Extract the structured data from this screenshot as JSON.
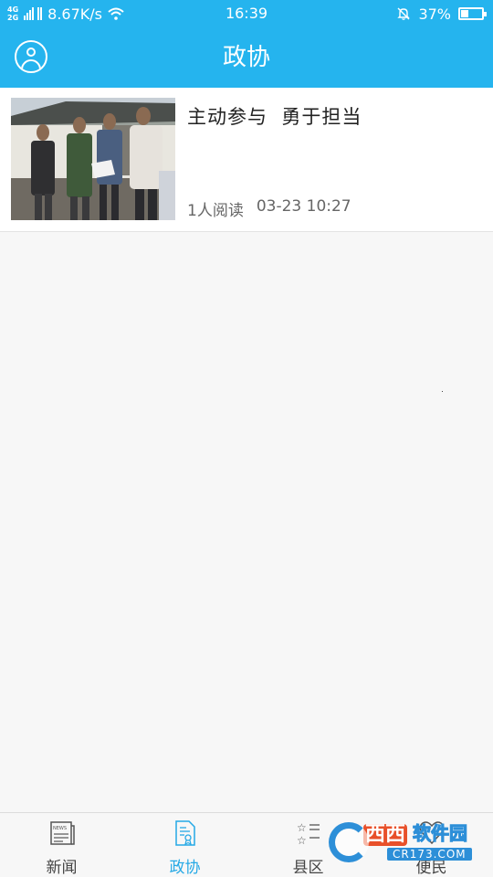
{
  "status_bar": {
    "network_type_top": "4G",
    "network_type_bottom": "2G",
    "speed": "8.67K/s",
    "time": "16:39",
    "battery_percent": "37%",
    "battery_level": 0.37
  },
  "header": {
    "title": "政协",
    "avatar_icon": "user-avatar-icon"
  },
  "news": [
    {
      "title": "主动参与  勇于担当",
      "reads": "1人阅读",
      "date": "03-23 10:27"
    }
  ],
  "tabs": [
    {
      "label": "新闻",
      "icon": "newspaper-icon",
      "active": false
    },
    {
      "label": "政协",
      "icon": "document-icon",
      "active": true
    },
    {
      "label": "县区",
      "icon": "star-list-icon",
      "active": false
    },
    {
      "label": "便民",
      "icon": "heart-icon",
      "active": false
    }
  ],
  "watermark": {
    "brand": "西西",
    "name": "软件园",
    "site": "CR173.COM"
  },
  "colors": {
    "primary": "#25b4ee",
    "active_tab": "#25a9e6",
    "background": "#f7f7f7"
  }
}
